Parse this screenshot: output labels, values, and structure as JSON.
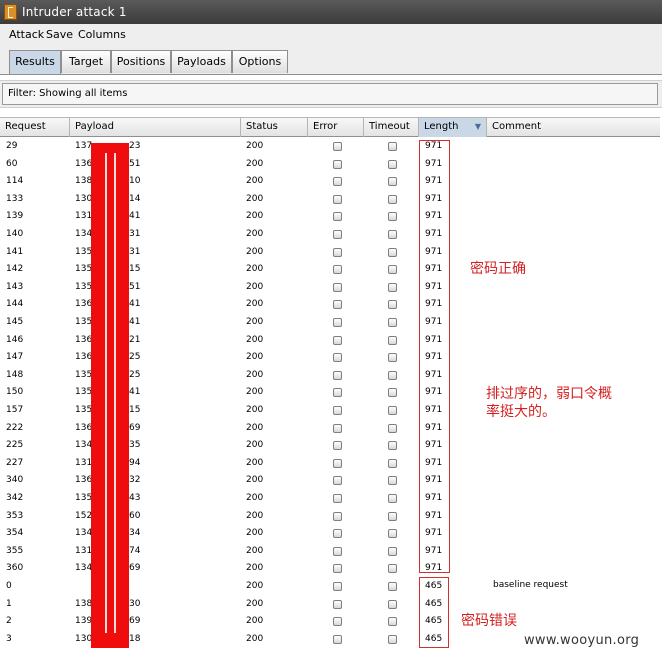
{
  "window": {
    "title": "Intruder attack 1"
  },
  "menu": [
    "Attack",
    "Save",
    "Columns"
  ],
  "tabs": [
    "Results",
    "Target",
    "Positions",
    "Payloads",
    "Options"
  ],
  "filter": "Filter:  Showing all items",
  "columns": [
    "Request",
    "Payload",
    "Status",
    "Error",
    "Timeout",
    "Length",
    "Comment"
  ],
  "rows": [
    {
      "request": "29",
      "payload_start": "137",
      "payload_end": "23",
      "status": "200",
      "length": "971"
    },
    {
      "request": "60",
      "payload_start": "136",
      "payload_end": "51",
      "status": "200",
      "length": "971"
    },
    {
      "request": "114",
      "payload_start": "138",
      "payload_end": "10",
      "status": "200",
      "length": "971"
    },
    {
      "request": "133",
      "payload_start": "130",
      "payload_end": "14",
      "status": "200",
      "length": "971"
    },
    {
      "request": "139",
      "payload_start": "131",
      "payload_end": "41",
      "status": "200",
      "length": "971"
    },
    {
      "request": "140",
      "payload_start": "134",
      "payload_end": "31",
      "status": "200",
      "length": "971"
    },
    {
      "request": "141",
      "payload_start": "135",
      "payload_end": "31",
      "status": "200",
      "length": "971"
    },
    {
      "request": "142",
      "payload_start": "135",
      "payload_end": "15",
      "status": "200",
      "length": "971"
    },
    {
      "request": "143",
      "payload_start": "135",
      "payload_end": "51",
      "status": "200",
      "length": "971"
    },
    {
      "request": "144",
      "payload_start": "136",
      "payload_end": "41",
      "status": "200",
      "length": "971"
    },
    {
      "request": "145",
      "payload_start": "135",
      "payload_end": "41",
      "status": "200",
      "length": "971"
    },
    {
      "request": "146",
      "payload_start": "136",
      "payload_end": "21",
      "status": "200",
      "length": "971"
    },
    {
      "request": "147",
      "payload_start": "136",
      "payload_end": "25",
      "status": "200",
      "length": "971"
    },
    {
      "request": "148",
      "payload_start": "135",
      "payload_end": "25",
      "status": "200",
      "length": "971"
    },
    {
      "request": "150",
      "payload_start": "135",
      "payload_end": "41",
      "status": "200",
      "length": "971"
    },
    {
      "request": "157",
      "payload_start": "135",
      "payload_end": "15",
      "status": "200",
      "length": "971"
    },
    {
      "request": "222",
      "payload_start": "136",
      "payload_end": "69",
      "status": "200",
      "length": "971"
    },
    {
      "request": "225",
      "payload_start": "134",
      "payload_end": "35",
      "status": "200",
      "length": "971"
    },
    {
      "request": "227",
      "payload_start": "131",
      "payload_end": "94",
      "status": "200",
      "length": "971"
    },
    {
      "request": "340",
      "payload_start": "136",
      "payload_end": "32",
      "status": "200",
      "length": "971"
    },
    {
      "request": "342",
      "payload_start": "135",
      "payload_end": "43",
      "status": "200",
      "length": "971"
    },
    {
      "request": "353",
      "payload_start": "152",
      "payload_end": "60",
      "status": "200",
      "length": "971"
    },
    {
      "request": "354",
      "payload_start": "134",
      "payload_end": "34",
      "status": "200",
      "length": "971"
    },
    {
      "request": "355",
      "payload_start": "131",
      "payload_end": "74",
      "status": "200",
      "length": "971"
    },
    {
      "request": "360",
      "payload_start": "134",
      "payload_end": "69",
      "status": "200",
      "length": "971"
    },
    {
      "request": "0",
      "payload_start": "",
      "payload_end": "",
      "status": "200",
      "length": "465"
    },
    {
      "request": "1",
      "payload_start": "138",
      "payload_end": "30",
      "status": "200",
      "length": "465"
    },
    {
      "request": "2",
      "payload_start": "139",
      "payload_end": "69",
      "status": "200",
      "length": "465"
    },
    {
      "request": "3",
      "payload_start": "130",
      "payload_end": "18",
      "status": "200",
      "length": "465"
    }
  ],
  "comment_baseline": "baseline request",
  "annotations": {
    "correct": "密码正确",
    "sorted_line1": "排过序的，弱口令概",
    "sorted_line2": "率挺大的。",
    "wrong": "密码错误"
  },
  "watermark": "www.wooyun.org",
  "colors": {
    "annotation_red": "#d42020",
    "redaction": "#ee0c0c",
    "selected_tab": "#c9d7e6"
  }
}
